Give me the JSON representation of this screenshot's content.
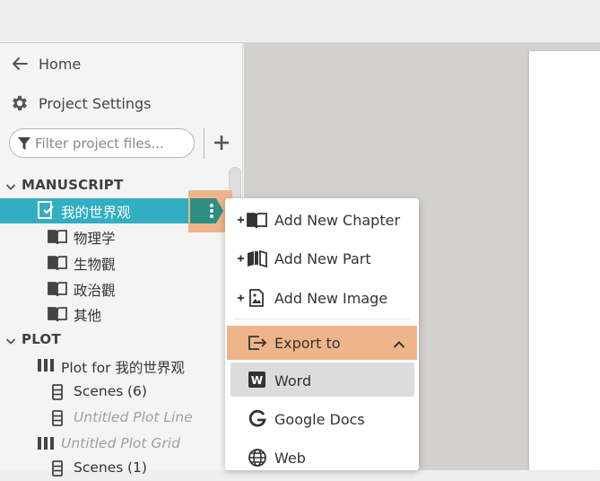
{
  "sidebar": {
    "home_label": "Home",
    "settings_label": "Project Settings",
    "filter_placeholder": "Filter project files...",
    "sections": {
      "manuscript": "MANUSCRIPT",
      "plot": "PLOT"
    },
    "manuscript_items": {
      "book": "我的世界观",
      "ch1": "物理学",
      "ch2": "生物觀",
      "ch3": "政治觀",
      "ch4": "其他"
    },
    "plot_items": {
      "grid1": "Plot for 我的世界观",
      "scenes": "Scenes",
      "scenes_count": "(6)",
      "untitled_line": "Untitled Plot Line",
      "untitled_grid": "Untitled Plot Grid",
      "scenes2": "Scenes",
      "scenes2_count": "(1)"
    }
  },
  "context_menu": {
    "add_chapter": "Add New Chapter",
    "add_part": "Add New Part",
    "add_image": "Add New Image",
    "export_to": "Export to",
    "export_options": {
      "word": "Word",
      "google_docs": "Google Docs",
      "web": "Web"
    }
  },
  "colors": {
    "selection": "#31aec2",
    "highlight": "#efb48a",
    "workspace": "#d2d1cd"
  }
}
